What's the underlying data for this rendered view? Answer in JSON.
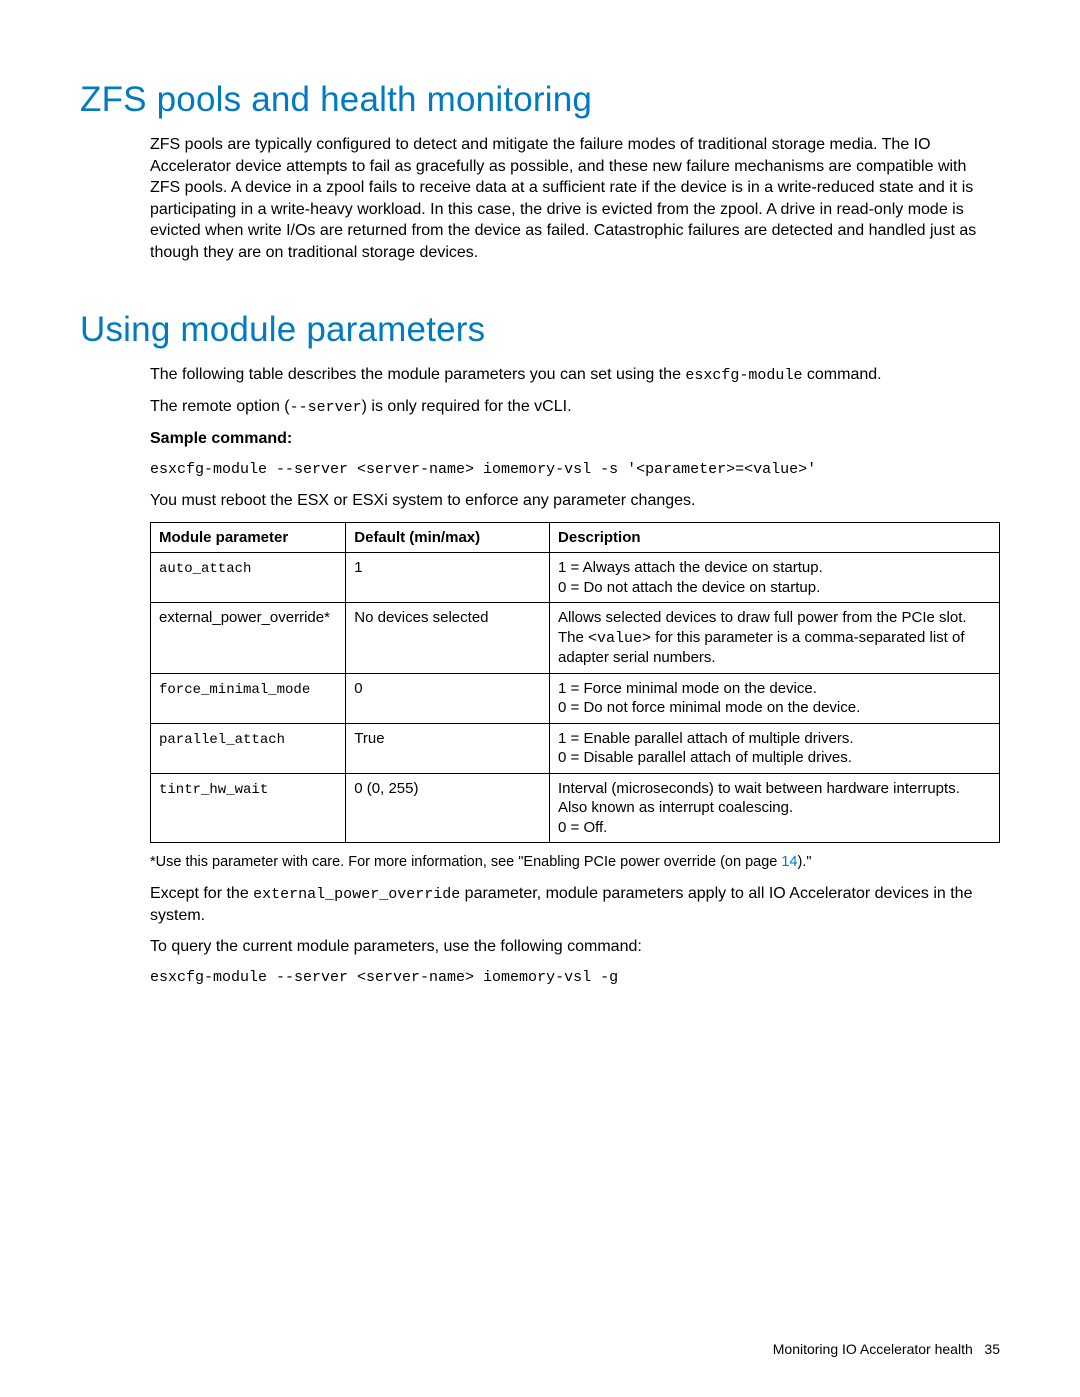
{
  "section1": {
    "title": "ZFS pools and health monitoring",
    "para": "ZFS pools are typically configured to detect and mitigate the failure modes of traditional storage media. The IO Accelerator device attempts to fail as gracefully as possible, and these new failure mechanisms are compatible with ZFS pools. A device in a zpool fails to receive data at a sufficient rate if the device is in a write-reduced state and it is participating in a write-heavy workload. In this case, the drive is evicted from the zpool. A drive in read-only mode is evicted when write I/Os are returned from the device as failed. Catastrophic failures are detected and handled just as though they are on traditional storage devices."
  },
  "section2": {
    "title": "Using module parameters",
    "intro1a": "The following table describes the module parameters you can set using the ",
    "intro1_code": "esxcfg-module",
    "intro1b": " command.",
    "intro2a": "The remote option (",
    "intro2_code": "--server",
    "intro2b": ") is only required for the vCLI.",
    "sample_label": "Sample command:",
    "sample_code": "esxcfg-module --server <server-name> iomemory-vsl -s '<parameter>=<value>'",
    "reboot_note": "You must reboot the ESX or ESXi system to enforce any parameter changes.",
    "table": {
      "headers": {
        "c1": "Module parameter",
        "c2": "Default (min/max)",
        "c3": "Description"
      },
      "rows": [
        {
          "param": "auto_attach",
          "param_mono": true,
          "def": "1",
          "desc_lines": [
            "1 = Always attach the device on startup.",
            "0 = Do not attach the device on startup."
          ]
        },
        {
          "param": "external_power_override*",
          "param_mono": false,
          "def": "No devices selected",
          "desc_pre": "Allows selected devices to draw full power from the PCIe slot. The ",
          "desc_code": "<value>",
          "desc_post": " for this parameter is a comma-separated list of adapter serial numbers."
        },
        {
          "param": "force_minimal_mode",
          "param_mono": true,
          "def": "0",
          "desc_lines": [
            "1 = Force minimal mode on the device.",
            "0 = Do not force minimal mode on the device."
          ]
        },
        {
          "param": "parallel_attach",
          "param_mono": true,
          "def": "True",
          "desc_lines": [
            "1 = Enable parallel attach of multiple drivers.",
            "0 = Disable parallel attach of multiple drives."
          ]
        },
        {
          "param": "tintr_hw_wait",
          "param_mono": true,
          "def": "0 (0, 255)",
          "desc_lines": [
            "Interval (microseconds) to wait between hardware interrupts. Also known as interrupt coalescing.",
            "0 = Off."
          ]
        }
      ]
    },
    "footnote_a": "*Use this parameter with care. For more information, see \"Enabling PCIe power override (on page ",
    "footnote_link": "14",
    "footnote_b": ").\"",
    "except_a": "Except for the ",
    "except_code": "external_power_override",
    "except_b": " parameter, module parameters apply to all IO Accelerator devices in the system.",
    "query_text": "To query the current module parameters, use the following command:",
    "query_code": "esxcfg-module --server <server-name> iomemory-vsl -g"
  },
  "footer": {
    "text": "Monitoring IO Accelerator health",
    "page": "35"
  }
}
